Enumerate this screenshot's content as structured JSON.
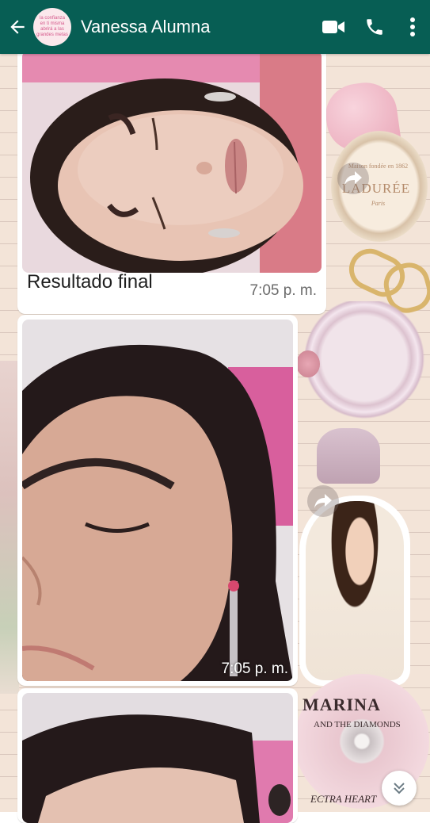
{
  "header": {
    "contact_name": "Vanessa Alumna",
    "avatar_text": "la confianza en ti misma abrirá a las grandes metas",
    "back_icon": "arrow-left-icon",
    "video_icon": "video-camera-icon",
    "call_icon": "phone-icon",
    "menu_icon": "more-vertical-icon",
    "color": "#075e54"
  },
  "messages": [
    {
      "type": "image",
      "caption": "Resultado final",
      "time": "7:05 p. m."
    },
    {
      "type": "image",
      "caption": "",
      "time": "7:05 p. m."
    },
    {
      "type": "image",
      "caption": "",
      "time": ""
    }
  ],
  "wallpaper": {
    "brand_text": "LADURÉE",
    "brand_sub": "Maison fondée en 1862",
    "brand_sub2": "Paris",
    "album_title": "MARINA",
    "album_sub": "AND THE DIAMONDS",
    "album_bottom": "ECTRA HEART"
  },
  "controls": {
    "forward_icon": "forward-arrow-icon",
    "scroll_down_icon": "chevron-double-down-icon"
  }
}
